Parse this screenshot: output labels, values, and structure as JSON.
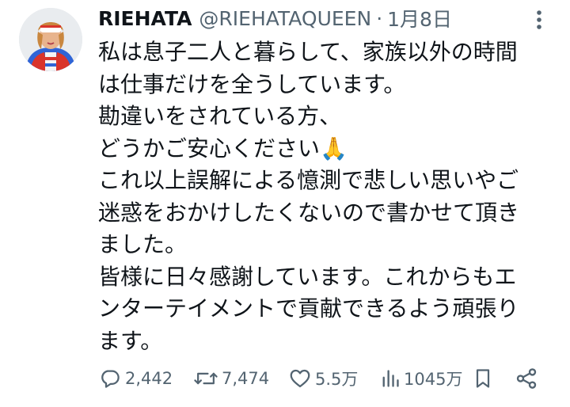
{
  "tweet": {
    "author": {
      "display_name": "RIEHATA",
      "handle": "@RIEHATAQUEEN"
    },
    "separator": "·",
    "date": "1月8日",
    "lines": [
      "私は息子二人と暮らして、家族以外の時間",
      "は仕事だけを全うしています。",
      "勘違いをされている方、",
      "どうかご安心ください🙏",
      "これ以上誤解による憶測で悲しい思いやご",
      "迷惑をおかけしたくないので書かせて頂き",
      "ました。",
      "皆様に日々感謝しています。これからもエ",
      "ンターテイメントで貢献できるよう頑張り",
      "ます。"
    ],
    "stats": {
      "replies": "2,442",
      "reposts": "7,474",
      "likes": "5.5万",
      "views": "1045万"
    },
    "icons": {
      "more": "more-dots-icon",
      "reply": "reply-bubble-icon",
      "repost": "repost-arrows-icon",
      "like": "heart-icon",
      "views": "bar-chart-icon",
      "bookmark": "bookmark-icon",
      "share": "share-icon"
    },
    "colors": {
      "text": "#0f1419",
      "secondary": "#536471",
      "background": "#ffffff"
    }
  }
}
